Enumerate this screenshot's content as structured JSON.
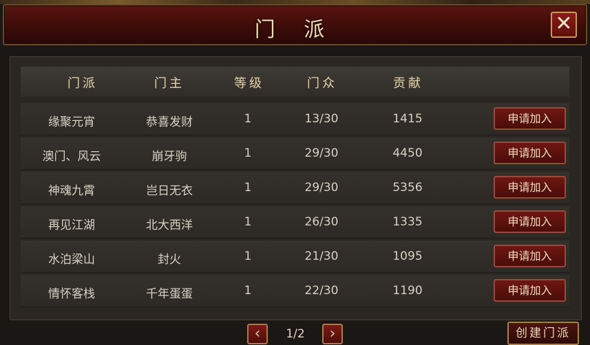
{
  "window": {
    "title": "门 派",
    "close_symbol": "✕"
  },
  "table": {
    "headers": [
      "门派",
      "门主",
      "等级",
      "门众",
      "贡献"
    ],
    "rows": [
      {
        "name": "缘聚元宵",
        "leader": "恭喜发财",
        "level": "1",
        "members": "13/30",
        "contribution": "1415",
        "action": "申请加入"
      },
      {
        "name": "澳门、风云",
        "leader": "崩牙驹",
        "level": "1",
        "members": "29/30",
        "contribution": "4450",
        "action": "申请加入"
      },
      {
        "name": "神魂九霄",
        "leader": "岂日无衣",
        "level": "1",
        "members": "29/30",
        "contribution": "5356",
        "action": "申请加入"
      },
      {
        "name": "再见江湖",
        "leader": "北大西洋",
        "level": "1",
        "members": "26/30",
        "contribution": "1335",
        "action": "申请加入"
      },
      {
        "name": "水泊梁山",
        "leader": "封火",
        "level": "1",
        "members": "21/30",
        "contribution": "1095",
        "action": "申请加入"
      },
      {
        "name": "情怀客栈",
        "leader": "千年蛋蛋",
        "level": "1",
        "members": "22/30",
        "contribution": "1190",
        "action": "申请加入"
      }
    ]
  },
  "pager": {
    "page": "1/2",
    "prev_icon": "‹",
    "next_icon": "›"
  },
  "create_button": "创建门派"
}
